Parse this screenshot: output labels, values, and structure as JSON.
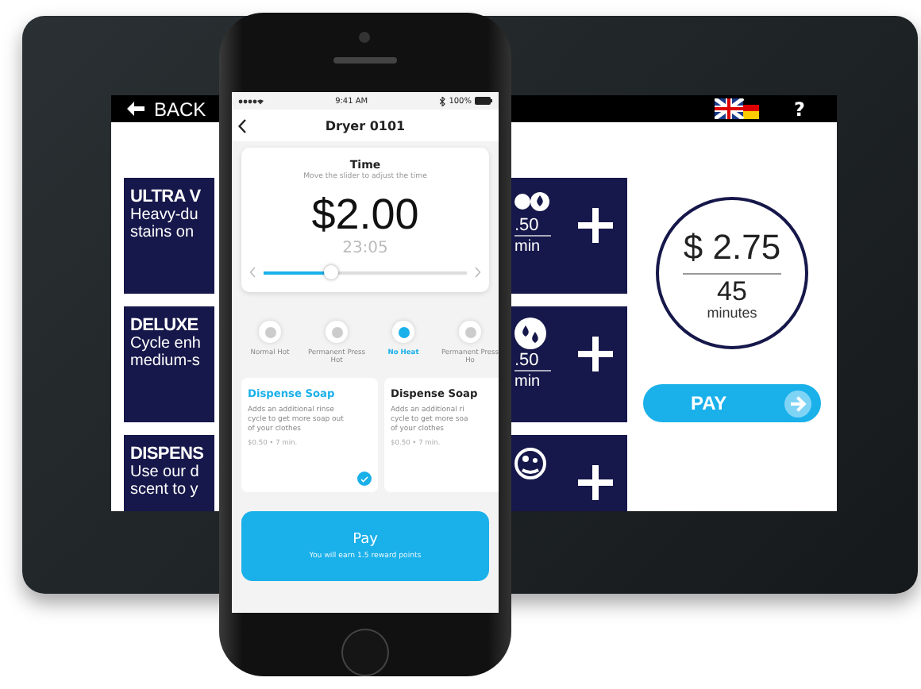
{
  "kiosk": {
    "top_bar": {
      "back_label": "BACK",
      "help": "?"
    },
    "cycles": [
      {
        "title": "ULTRA V",
        "lines": [
          "Heavy-du",
          "stains on"
        ],
        "price": ".50",
        "unit": "min"
      },
      {
        "title": "DELUXE",
        "lines": [
          "Cycle enh",
          "medium-s"
        ],
        "price": ".50",
        "unit": "min"
      },
      {
        "title": "DISPENS",
        "lines": [
          "Use our d",
          "scent to y"
        ]
      }
    ],
    "total": {
      "price": "$ 2.75",
      "minutes": "45",
      "unit": "minutes"
    },
    "pay_button": "PAY"
  },
  "phone": {
    "status_bar": {
      "time": "9:41 AM",
      "battery": "100%"
    },
    "header": {
      "title": "Dryer 0101"
    },
    "time_card": {
      "title": "Time",
      "hint": "Move the slider to adjust the time",
      "price": "$2.00",
      "duration": "23:05",
      "level": 0.33
    },
    "heat_options": [
      {
        "label": "Normal Hot",
        "selected": false
      },
      {
        "label": "Permanent Press Hot",
        "selected": false
      },
      {
        "label": "No Heat",
        "selected": true
      },
      {
        "label": "Permanent Press Ho",
        "selected": false
      }
    ],
    "extras": [
      {
        "title": "Dispense Soap",
        "lines": [
          "Adds an additional rinse",
          "cycle to get more soap out",
          "of your clothes"
        ],
        "meta": "$0.50 • 7 min.",
        "selected": true
      },
      {
        "title": "Dispense Soap",
        "lines": [
          "Adds an additional ri",
          "cycle to get more soa",
          "of your clothes"
        ],
        "meta": "$0.50 • 7 min.",
        "selected": false
      }
    ],
    "pay_button": {
      "label": "Pay",
      "note": "You will earn 1.5 reward points"
    }
  }
}
